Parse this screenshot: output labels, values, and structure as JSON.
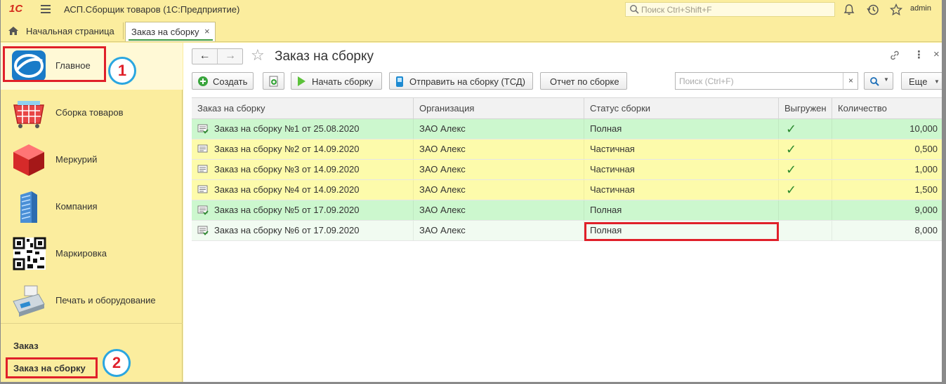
{
  "titlebar": {
    "logo": "1С",
    "title": "АСП.Сборщик товаров  (1С:Предприятие)",
    "search_placeholder": "Поиск Ctrl+Shift+F",
    "user": "admin"
  },
  "tabs": {
    "home_label": "Начальная страница",
    "active_label": "Заказ на сборку",
    "close_glyph": "×"
  },
  "sidebar": {
    "items": [
      {
        "label": "Главное",
        "icon": "main-globe-icon"
      },
      {
        "label": "Сборка товаров",
        "icon": "basket-icon"
      },
      {
        "label": "Меркурий",
        "icon": "cube-icon"
      },
      {
        "label": "Компания",
        "icon": "building-icon"
      },
      {
        "label": "Маркировка",
        "icon": "qr-code-icon"
      },
      {
        "label": "Печать и оборудование",
        "icon": "cash-register-icon"
      }
    ],
    "links": [
      "Заказ",
      "Заказ на сборку"
    ]
  },
  "form": {
    "title": "Заказ на сборку",
    "back": "←",
    "forward": "→",
    "star": "☆",
    "link_glyph": "🔗",
    "more_glyph": "⋮",
    "close_glyph": "×"
  },
  "commands": {
    "create": "Создать",
    "start": "Начать сборку",
    "send": "Отправить на сборку (ТСД)",
    "report": "Отчет по сборке",
    "search_placeholder": "Поиск (Ctrl+F)",
    "clear": "×",
    "more": "Еще"
  },
  "table": {
    "columns": [
      "Заказ на сборку",
      "Организация",
      "Статус сборки",
      "Выгружен",
      "Количество"
    ],
    "rows": [
      {
        "name": "Заказ на сборку №1 от 25.08.2020",
        "org": "ЗАО Алекс",
        "status": "Полная",
        "unloaded": true,
        "qty": "10,000"
      },
      {
        "name": "Заказ на сборку №2 от 14.09.2020",
        "org": "ЗАО Алекс",
        "status": "Частичная",
        "unloaded": true,
        "qty": "0,500"
      },
      {
        "name": "Заказ на сборку №3 от 14.09.2020",
        "org": "ЗАО Алекс",
        "status": "Частичная",
        "unloaded": true,
        "qty": "1,000"
      },
      {
        "name": "Заказ на сборку №4 от 14.09.2020",
        "org": "ЗАО Алекс",
        "status": "Частичная",
        "unloaded": true,
        "qty": "1,500"
      },
      {
        "name": "Заказ на сборку №5 от 17.09.2020",
        "org": "ЗАО Алекс",
        "status": "Полная",
        "unloaded": false,
        "qty": "9,000"
      },
      {
        "name": "Заказ на сборку №6 от 17.09.2020",
        "org": "ЗАО Алекс",
        "status": "Полная",
        "unloaded": false,
        "qty": "8,000"
      }
    ],
    "check_glyph": "✓"
  },
  "annotations": {
    "marker1": "1",
    "marker2": "2"
  },
  "colors": {
    "row_full": "#ccf7ce",
    "row_partial": "#fdfbab",
    "row_last": "#f1fbf1",
    "accent_red": "#e0202a",
    "accent_blue": "#2aa6e0"
  }
}
